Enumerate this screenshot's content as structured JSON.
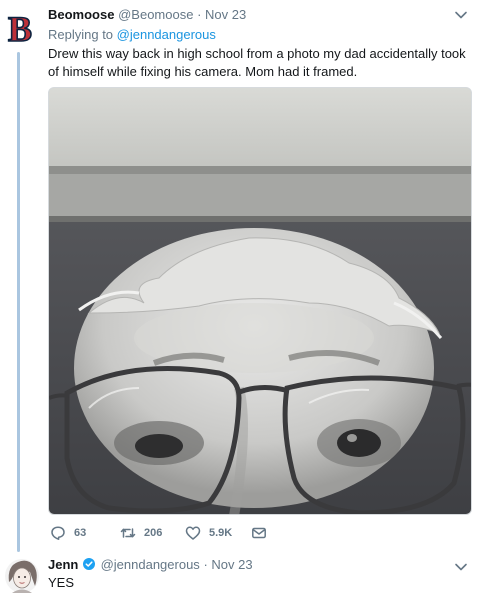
{
  "tweet1": {
    "display_name": "Beomoose",
    "handle": "@Beomoose",
    "separator": "·",
    "date": "Nov 23",
    "replying_prefix": "Replying to ",
    "replying_to": "@jenndangerous",
    "text": "Drew this way back in high school from a photo my dad accidentally took of himself while fixing his camera. Mom had it framed.",
    "avatar_icon": "red-sox-b-logo",
    "stats": {
      "replies": "63",
      "retweets": "206",
      "likes": "5.9K"
    }
  },
  "tweet2": {
    "display_name": "Jenn",
    "handle": "@jenndangerous",
    "separator": "·",
    "date": "Nov 23",
    "text": "YES",
    "verified": true
  },
  "colors": {
    "link": "#1b95e0",
    "muted": "#657786",
    "thread_line": "#aac6e0",
    "logo_red": "#bd3039",
    "logo_navy": "#0c2340"
  },
  "icons": [
    "reply-icon",
    "retweet-icon",
    "like-icon",
    "direct-message-icon",
    "chevron-down-icon",
    "verified-badge-icon"
  ]
}
